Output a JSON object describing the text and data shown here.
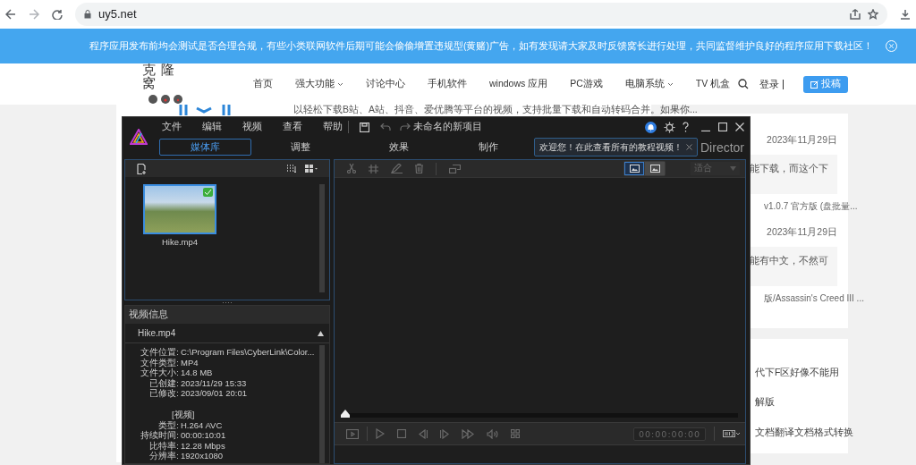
{
  "browser": {
    "url": "uy5.net"
  },
  "banner": {
    "text": "程序应用发布前均会测试是否合理合规，有些小类联网软件后期可能会偷偷增置违规型(黄赌)广告，如有发现请大家及时反馈窝长进行处理，共同监督维护良好的程序应用下载社区！"
  },
  "site_nav": {
    "logo": "克隆窝",
    "items": [
      {
        "label": "首页",
        "dropdown": false
      },
      {
        "label": "强大功能",
        "dropdown": true
      },
      {
        "label": "讨论中心",
        "dropdown": false
      },
      {
        "label": "手机软件",
        "dropdown": false
      },
      {
        "label": "windows 应用",
        "dropdown": false
      },
      {
        "label": "PC游戏",
        "dropdown": false
      },
      {
        "label": "电脑系统",
        "dropdown": true
      },
      {
        "label": "TV 机盒",
        "dropdown": false
      }
    ],
    "login": "登录",
    "post_button": "投稿"
  },
  "article": {
    "snippet": "以轻松下载B站、A站、抖音、爱优腾等平台的视频，支持批量下载和自动转码合并。如果你..."
  },
  "sidebar": {
    "entries": [
      {
        "date": "2023年11月29日",
        "excerpt": "能下载，而这个下",
        "title": "v1.0.7 官方版 (盘批量..."
      },
      {
        "date": "2023年11月29日",
        "excerpt": "能有中文，不然可",
        "title": "版/Assassin's Creed III ..."
      }
    ],
    "lines": [
      "代下F区好像不能用",
      "解版",
      "文档翻译文档格式转换"
    ]
  },
  "app": {
    "menu": [
      "文件",
      "编辑",
      "视频",
      "查看",
      "帮助"
    ],
    "project_title": "未命名的新项目",
    "tabs": [
      {
        "label": "媒体库",
        "selected": true
      },
      {
        "label": "调整",
        "selected": false
      },
      {
        "label": "效果",
        "selected": false
      },
      {
        "label": "制作",
        "selected": false
      }
    ],
    "tooltip": "欢迎您！在此查看所有的教程视频！",
    "brand_fragment": "Director",
    "media": [
      {
        "name": "Hike.mp4",
        "selected": true
      }
    ],
    "info": {
      "title": "视频信息",
      "file": "Hike.mp4",
      "fields": [
        {
          "label": "文件位置:",
          "value": "C:\\Program Files\\CyberLink\\Color..."
        },
        {
          "label": "文件类型:",
          "value": "MP4"
        },
        {
          "label": "文件大小:",
          "value": "14.8 MB"
        },
        {
          "label": "已创建:",
          "value": "2023/11/29 15:33"
        },
        {
          "label": "已修改:",
          "value": "2023/09/01 20:01"
        }
      ],
      "section": "[视频]",
      "video_fields": [
        {
          "label": "类型:",
          "value": "H.264 AVC"
        },
        {
          "label": "持续时间:",
          "value": "00:00:10:01"
        },
        {
          "label": "比特率:",
          "value": "12.28 Mbps"
        },
        {
          "label": "分辨率:",
          "value": "1920x1080"
        }
      ]
    },
    "preview": {
      "view_modes": [
        {
          "selected": true
        },
        {
          "selected": false
        }
      ],
      "zoom": "适合",
      "scrubber": {
        "level": 0
      },
      "timecode": "00:00:00:00"
    }
  }
}
